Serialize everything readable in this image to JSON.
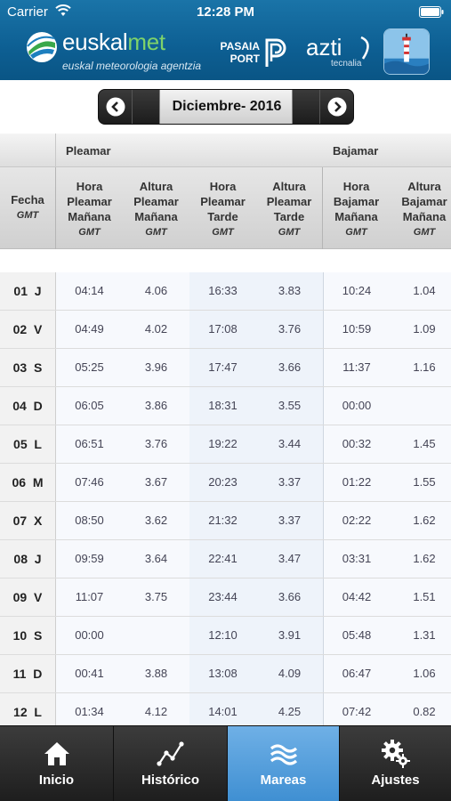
{
  "status": {
    "carrier": "Carrier",
    "time": "12:28 PM"
  },
  "header": {
    "logo_name_a": "euskal",
    "logo_name_b": "met",
    "logo_tagline": "euskal meteorologia agentzia",
    "pasaia_line1": "PASAIA",
    "pasaia_line2": "PORT",
    "azti_name": "azti",
    "azti_sub": "tecnalia"
  },
  "month_selector": {
    "label": "Diciembre- 2016"
  },
  "table": {
    "groups": {
      "pleamar": "Pleamar",
      "bajamar": "Bajamar"
    },
    "columns": [
      {
        "title": "Fecha",
        "sub": "GMT"
      },
      {
        "title": "Hora Pleamar Mañana",
        "sub": "GMT"
      },
      {
        "title": "Altura Pleamar Mañana",
        "sub": "GMT"
      },
      {
        "title": "Hora Pleamar Tarde",
        "sub": "GMT"
      },
      {
        "title": "Altura Pleamar Tarde",
        "sub": "GMT"
      },
      {
        "title": "Hora Bajamar Mañana",
        "sub": "GMT"
      },
      {
        "title": "Altura Bajamar Mañana",
        "sub": "GMT"
      }
    ],
    "rows": [
      [
        "01  J",
        "04:14",
        "4.06",
        "16:33",
        "3.83",
        "10:24",
        "1.04"
      ],
      [
        "02  V",
        "04:49",
        "4.02",
        "17:08",
        "3.76",
        "10:59",
        "1.09"
      ],
      [
        "03  S",
        "05:25",
        "3.96",
        "17:47",
        "3.66",
        "11:37",
        "1.16"
      ],
      [
        "04  D",
        "06:05",
        "3.86",
        "18:31",
        "3.55",
        "00:00",
        ""
      ],
      [
        "05  L",
        "06:51",
        "3.76",
        "19:22",
        "3.44",
        "00:32",
        "1.45"
      ],
      [
        "06  M",
        "07:46",
        "3.67",
        "20:23",
        "3.37",
        "01:22",
        "1.55"
      ],
      [
        "07  X",
        "08:50",
        "3.62",
        "21:32",
        "3.37",
        "02:22",
        "1.62"
      ],
      [
        "08  J",
        "09:59",
        "3.64",
        "22:41",
        "3.47",
        "03:31",
        "1.62"
      ],
      [
        "09  V",
        "11:07",
        "3.75",
        "23:44",
        "3.66",
        "04:42",
        "1.51"
      ],
      [
        "10  S",
        "00:00",
        "",
        "12:10",
        "3.91",
        "05:48",
        "1.31"
      ],
      [
        "11  D",
        "00:41",
        "3.88",
        "13:08",
        "4.09",
        "06:47",
        "1.06"
      ],
      [
        "12  L",
        "01:34",
        "4.12",
        "14:01",
        "4.25",
        "07:42",
        "0.82"
      ]
    ]
  },
  "tabs": [
    {
      "label": "Inicio",
      "icon": "home-icon"
    },
    {
      "label": "Histórico",
      "icon": "chart-icon"
    },
    {
      "label": "Mareas",
      "icon": "waves-icon",
      "active": true
    },
    {
      "label": "Ajustes",
      "icon": "gears-icon"
    }
  ],
  "colors": {
    "header_blue": "#0d5f93",
    "active_tab": "#4a96d6",
    "logo_green": "#7fd36a"
  }
}
